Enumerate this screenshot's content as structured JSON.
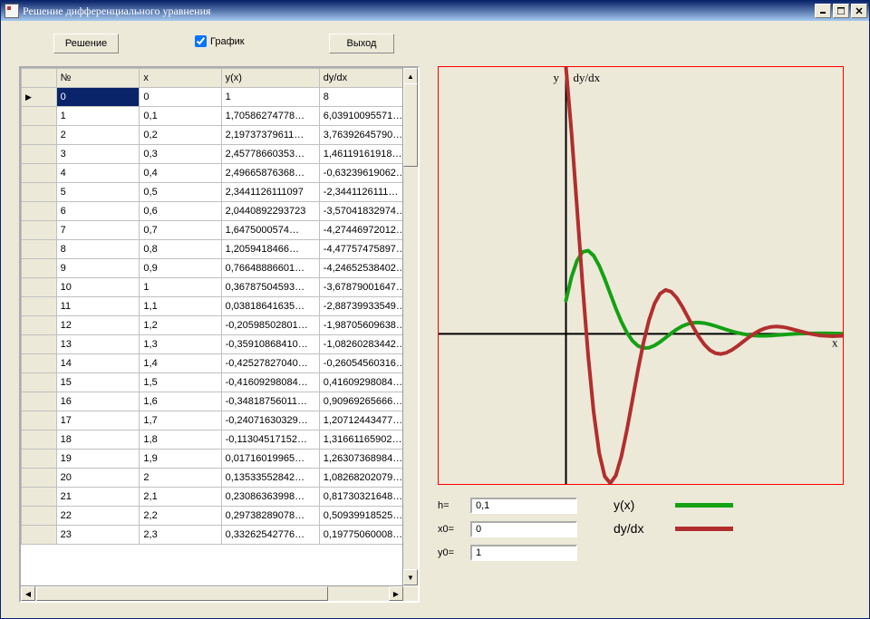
{
  "window": {
    "title": "Решение дифференциального уравнения"
  },
  "toolbar": {
    "solve_label": "Решение",
    "exit_label": "Выход",
    "chart_label": "График",
    "chart_checked": true
  },
  "grid": {
    "headers": {
      "num": "№",
      "x": "x",
      "y": "y(x)",
      "dy": "dy/dx"
    },
    "rows": [
      {
        "n": "0",
        "x": "0",
        "y": "1",
        "dy": "8",
        "selected": true
      },
      {
        "n": "1",
        "x": "0,1",
        "y": "1,70586274778…",
        "dy": "6,03910095571…"
      },
      {
        "n": "2",
        "x": "0,2",
        "y": "2,19737379611…",
        "dy": "3,76392645790…"
      },
      {
        "n": "3",
        "x": "0,3",
        "y": "2,45778660353…",
        "dy": "1,46119161918…"
      },
      {
        "n": "4",
        "x": "0,4",
        "y": "2,49665876368…",
        "dy": "-0,63239619062…"
      },
      {
        "n": "5",
        "x": "0,5",
        "y": "2,3441126111097",
        "dy": "-2,3441126111…"
      },
      {
        "n": "6",
        "x": "0,6",
        "y": "2,0440892293723",
        "dy": "-3,57041832974…"
      },
      {
        "n": "7",
        "x": "0,7",
        "y": "1,6475000574…",
        "dy": "-4,27446972012…"
      },
      {
        "n": "8",
        "x": "0,8",
        "y": "1,2059418466…",
        "dy": "-4,47757475897…"
      },
      {
        "n": "9",
        "x": "0,9",
        "y": "0,76648886601…",
        "dy": "-4,24652538402…"
      },
      {
        "n": "10",
        "x": "1",
        "y": "0,36787504593…",
        "dy": "-3,67879001647…"
      },
      {
        "n": "11",
        "x": "1,1",
        "y": "0,03818641635…",
        "dy": "-2,88739933549…"
      },
      {
        "n": "12",
        "x": "1,2",
        "y": "-0,20598502801…",
        "dy": "-1,98705609638…"
      },
      {
        "n": "13",
        "x": "1,3",
        "y": "-0,35910868410…",
        "dy": "-1,08260283442…"
      },
      {
        "n": "14",
        "x": "1,4",
        "y": "-0,42527827040…",
        "dy": "-0,26054560316…"
      },
      {
        "n": "15",
        "x": "1,5",
        "y": "-0,41609298084…",
        "dy": "0,41609298084…"
      },
      {
        "n": "16",
        "x": "1,6",
        "y": "-0,34818756011…",
        "dy": "0,90969265666…"
      },
      {
        "n": "17",
        "x": "1,7",
        "y": "-0,24071630329…",
        "dy": "1,20712443477…"
      },
      {
        "n": "18",
        "x": "1,8",
        "y": "-0,11304517152…",
        "dy": "1,31661165902…"
      },
      {
        "n": "19",
        "x": "1,9",
        "y": "0,01716019965…",
        "dy": "1,26307368984…"
      },
      {
        "n": "20",
        "x": "2",
        "y": "0,13533552842…",
        "dy": "1,08268202079…"
      },
      {
        "n": "21",
        "x": "2,1",
        "y": "0,23086363998…",
        "dy": "0,81730321648…"
      },
      {
        "n": "22",
        "x": "2,2",
        "y": "0,29738289078…",
        "dy": "0,50939918525…"
      },
      {
        "n": "23",
        "x": "2,3",
        "y": "0,33262542776…",
        "dy": "0,19775060008…"
      }
    ]
  },
  "params": {
    "h_label": "h=",
    "h_value": "0,1",
    "x0_label": "x0=",
    "x0_value": "0",
    "y0_label": "y0=",
    "y0_value": "1"
  },
  "legend": {
    "y_label": "y(x)",
    "dy_label": "dy/dx"
  },
  "chart_data": {
    "type": "line",
    "xlabel": "x",
    "ylabel": "y",
    "axis_y_label_top": "y",
    "axis_dy_label_top": "dy/dx",
    "xlim": [
      -2.3,
      5.0
    ],
    "ylim": [
      -4.5,
      8.0
    ],
    "x_axis_origin": 0,
    "series": [
      {
        "name": "y(x)",
        "color": "#14a114",
        "x": [
          0,
          0.1,
          0.2,
          0.3,
          0.4,
          0.5,
          0.6,
          0.7,
          0.8,
          0.9,
          1,
          1.1,
          1.2,
          1.3,
          1.4,
          1.5,
          1.6,
          1.7,
          1.8,
          1.9,
          2,
          2.1,
          2.2,
          2.3,
          2.4,
          2.5,
          2.6,
          2.7,
          2.8,
          2.9,
          3,
          3.1,
          3.2,
          3.3,
          3.4,
          3.5,
          3.6,
          3.7,
          3.8,
          3.9,
          4,
          4.2,
          4.4,
          4.6,
          4.8,
          5
        ],
        "y": [
          1,
          1.706,
          2.197,
          2.458,
          2.497,
          2.344,
          2.044,
          1.648,
          1.206,
          0.766,
          0.368,
          0.038,
          -0.206,
          -0.359,
          -0.425,
          -0.416,
          -0.348,
          -0.241,
          -0.113,
          0.017,
          0.135,
          0.231,
          0.297,
          0.333,
          0.339,
          0.321,
          0.284,
          0.235,
          0.181,
          0.126,
          0.075,
          0.031,
          -0.005,
          -0.032,
          -0.049,
          -0.057,
          -0.056,
          -0.049,
          -0.038,
          -0.025,
          -0.013,
          0.006,
          0.015,
          0.017,
          0.013,
          0.008
        ]
      },
      {
        "name": "dy/dx",
        "color": "#b22e2e",
        "x": [
          0,
          0.1,
          0.2,
          0.3,
          0.4,
          0.5,
          0.6,
          0.7,
          0.8,
          0.9,
          1,
          1.1,
          1.2,
          1.3,
          1.4,
          1.5,
          1.6,
          1.7,
          1.8,
          1.9,
          2,
          2.1,
          2.2,
          2.3,
          2.4,
          2.5,
          2.6,
          2.7,
          2.8,
          2.9,
          3,
          3.1,
          3.2,
          3.3,
          3.4,
          3.5,
          3.6,
          3.7,
          3.8,
          3.9,
          4,
          4.2,
          4.4,
          4.6,
          4.8,
          5
        ],
        "y": [
          8,
          6.039,
          3.764,
          1.461,
          -0.632,
          -2.344,
          -3.57,
          -4.274,
          -4.478,
          -4.247,
          -3.679,
          -2.887,
          -1.987,
          -1.083,
          -0.261,
          0.416,
          0.91,
          1.207,
          1.317,
          1.263,
          1.083,
          0.817,
          0.509,
          0.198,
          -0.089,
          -0.321,
          -0.487,
          -0.58,
          -0.603,
          -0.564,
          -0.479,
          -0.363,
          -0.234,
          -0.107,
          0.008,
          0.102,
          0.17,
          0.209,
          0.221,
          0.209,
          0.179,
          0.092,
          0.006,
          -0.05,
          -0.069,
          -0.057
        ]
      }
    ]
  }
}
